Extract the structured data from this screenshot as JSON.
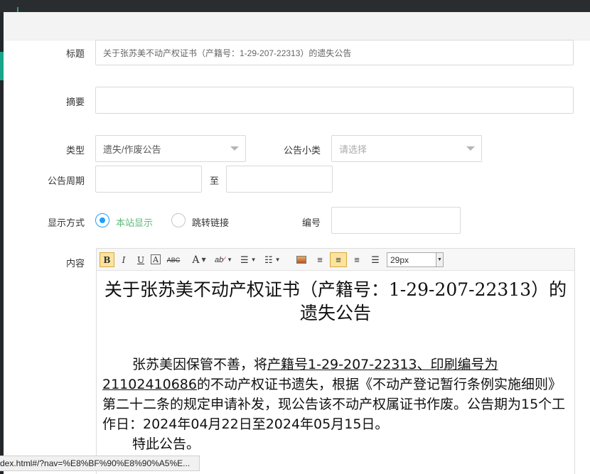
{
  "form": {
    "title_label": "标题",
    "title_value": "关于张苏美不动产权证书（产籍号：1-29-207-22313）的遗失公告",
    "summary_label": "摘要",
    "summary_value": "",
    "type_label": "类型",
    "type_value": "遗失/作废公告",
    "subtype_label": "公告小类",
    "subtype_placeholder": "请选择",
    "period_label": "公告周期",
    "period_to": "至",
    "display_label": "显示方式",
    "display_options": [
      "本站显示",
      "跳转链接"
    ],
    "display_selected": "本站显示",
    "number_label": "编号",
    "content_label": "内容"
  },
  "editor": {
    "font_size": "29px",
    "toolbar": {
      "bold": "B",
      "italic": "I",
      "underline": "U",
      "font": "A",
      "strike": "ABC",
      "font_color": "A",
      "highlight": "ab"
    },
    "doc_title": "关于张苏美不动产权证书（产籍号：1-29-207-22313）的遗失公告",
    "para1_a": "张苏美因保管不善，将",
    "para1_u": "产籍号1-29-207-22313、印刷编号为21102410686",
    "para1_b": "的不动产权证书遗失，根据《不动产登记暂行条例实施细则》第二十二条的规定申请补发，现公告该不动产权属证书作废。公告期为15个工作日：2024年04月22日至2024年05月15日。",
    "para2": "特此公告。"
  },
  "status_url": "dex.html#/?nav=%E8%BF%90%E8%90%A5%E..."
}
